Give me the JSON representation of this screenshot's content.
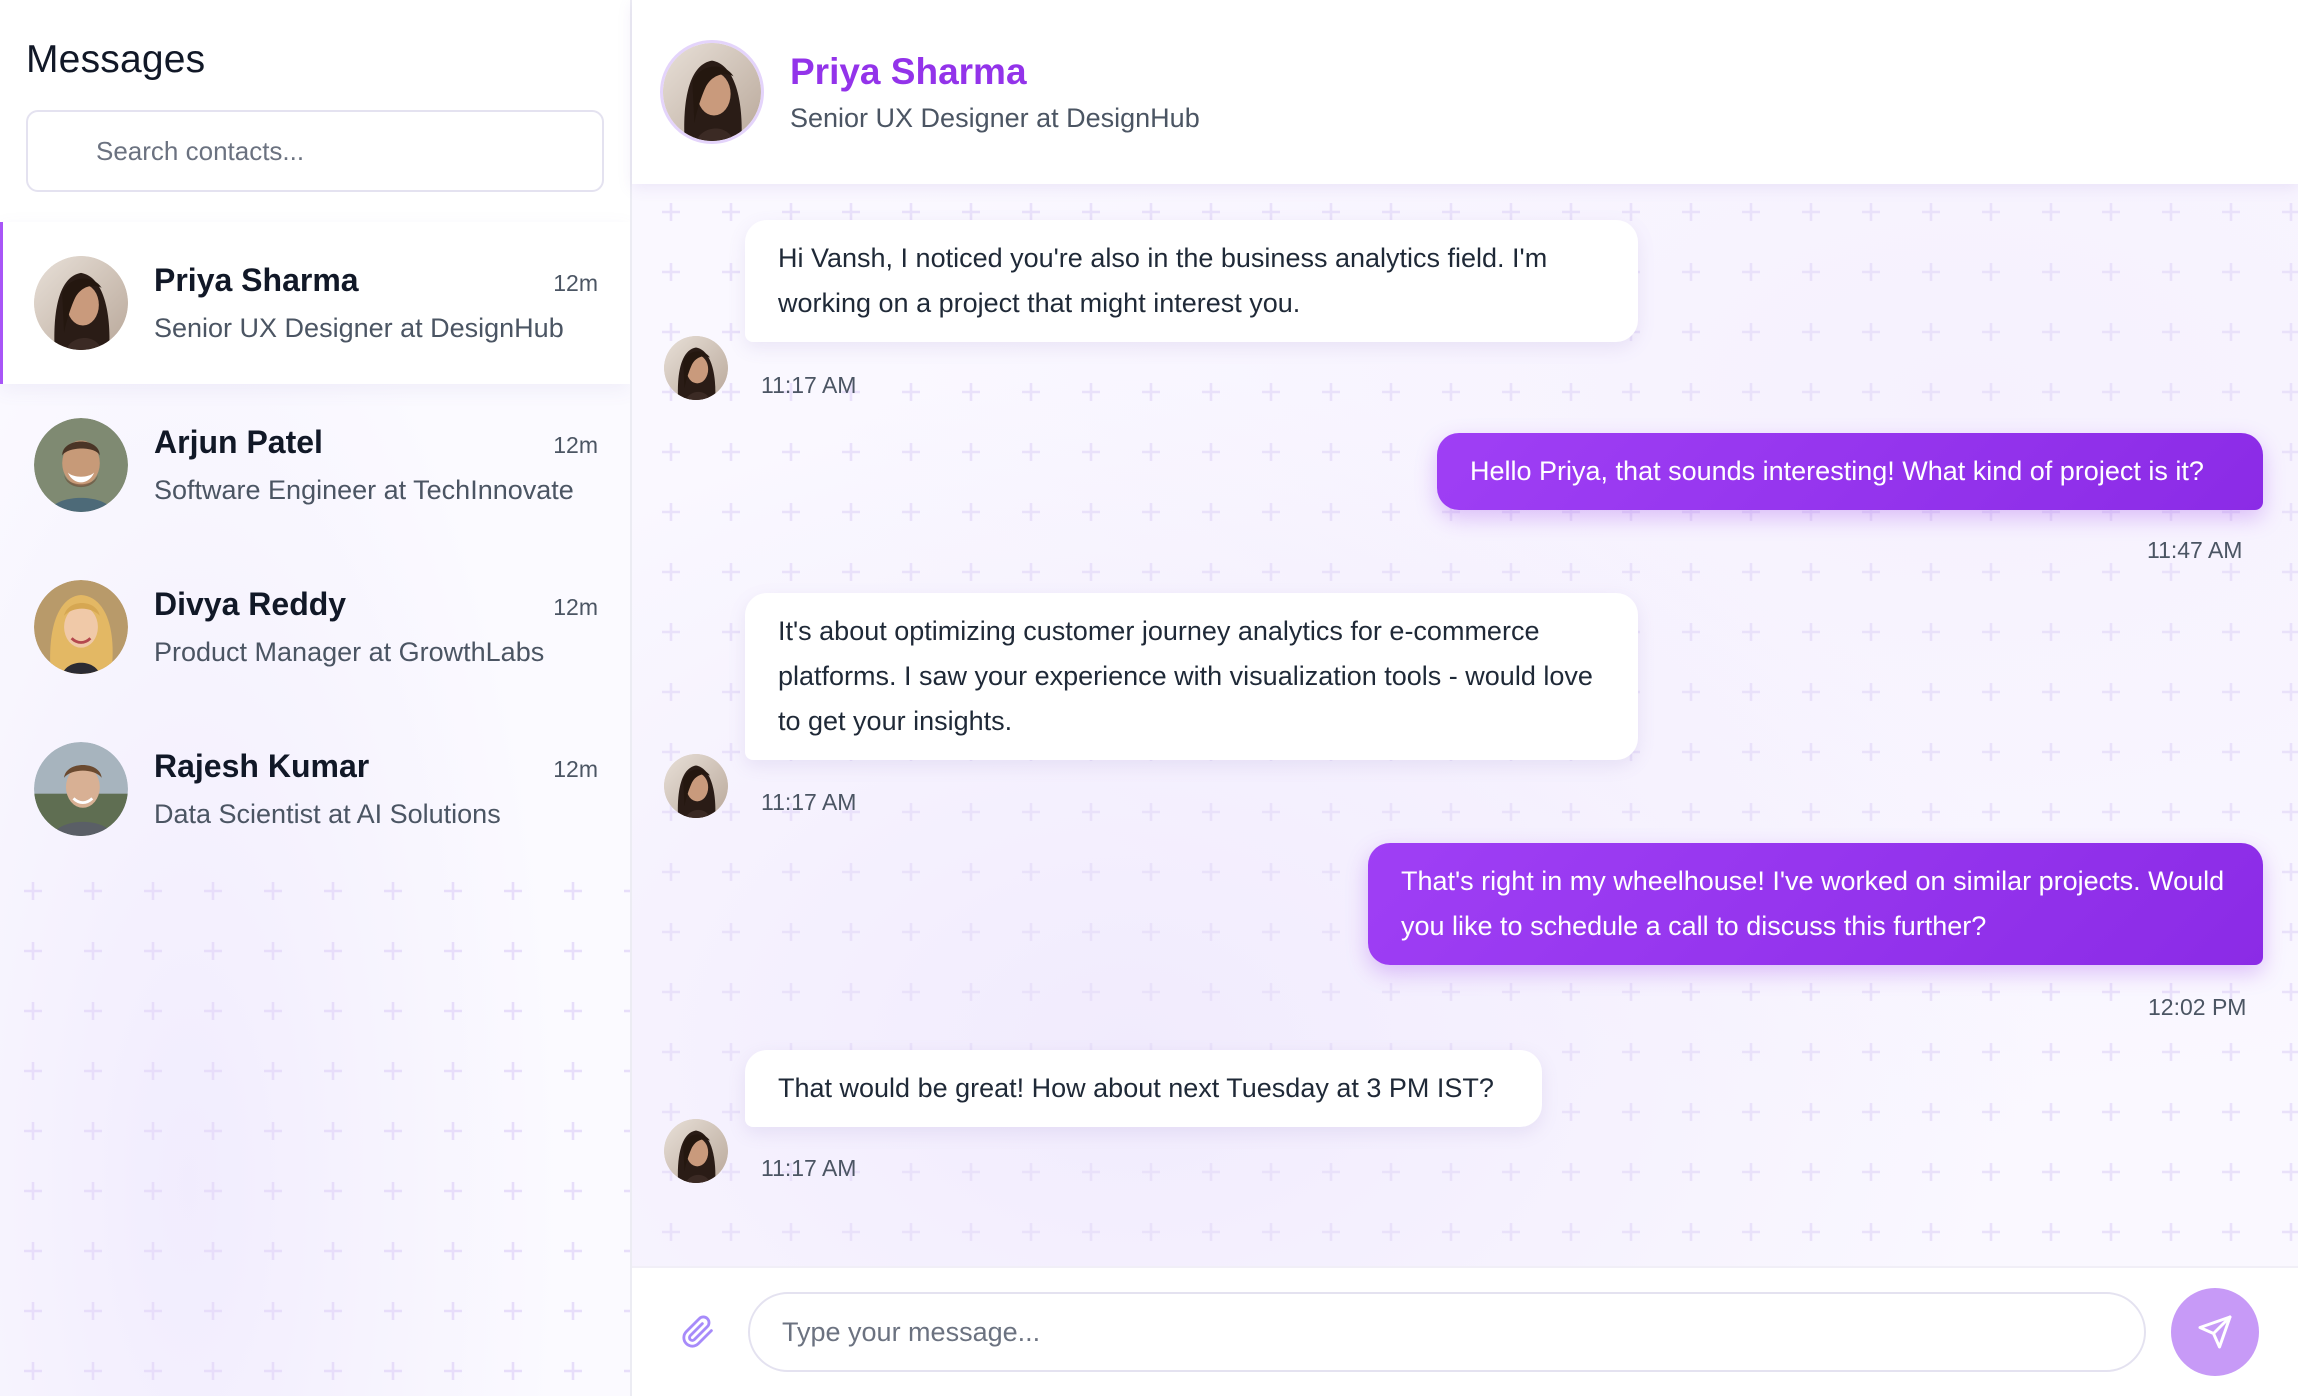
{
  "sidebar": {
    "title": "Messages",
    "search_placeholder": "Search contacts...",
    "contacts": [
      {
        "name": "Priya Sharma",
        "time": "12m",
        "role": "Senior UX Designer at DesignHub",
        "avatar": "avatar-woman-dark-hair"
      },
      {
        "name": "Arjun Patel",
        "time": "12m",
        "role": "Software Engineer at TechInnovate",
        "avatar": "avatar-man-smiling"
      },
      {
        "name": "Divya Reddy",
        "time": "12m",
        "role": "Product Manager at GrowthLabs",
        "avatar": "avatar-woman-blonde"
      },
      {
        "name": "Rajesh Kumar",
        "time": "12m",
        "role": "Data Scientist at AI Solutions",
        "avatar": "avatar-man-outdoors"
      }
    ]
  },
  "chat": {
    "header": {
      "name": "Priya Sharma",
      "role": "Senior UX Designer at DesignHub"
    },
    "messages": [
      {
        "direction": "in",
        "text": "Hi Vansh, I noticed you're also in the business analytics field. I'm working on a project that might interest you.",
        "time": "11:17 AM"
      },
      {
        "direction": "out",
        "text": "Hello Priya, that sounds interesting! What kind of project is it?",
        "time": "11:47 AM"
      },
      {
        "direction": "in",
        "text": "It's about optimizing customer journey analytics for e-commerce platforms. I saw your experience with visualization tools - would love to get your insights.",
        "time": "11:17 AM"
      },
      {
        "direction": "out",
        "text": "That's right in my wheelhouse! I've worked on similar projects. Would you like to schedule a call to discuss this further?",
        "time": "12:02 PM"
      },
      {
        "direction": "in",
        "text": "That would be great! How about next Tuesday at 3 PM IST?",
        "time": "11:17 AM"
      }
    ],
    "composer": {
      "placeholder": "Type your message..."
    }
  },
  "colors": {
    "accent": "#9333ea",
    "outgoing_bubble": "#8b2be6",
    "send_button": "#c79af7",
    "active_border": "#a855f7"
  }
}
